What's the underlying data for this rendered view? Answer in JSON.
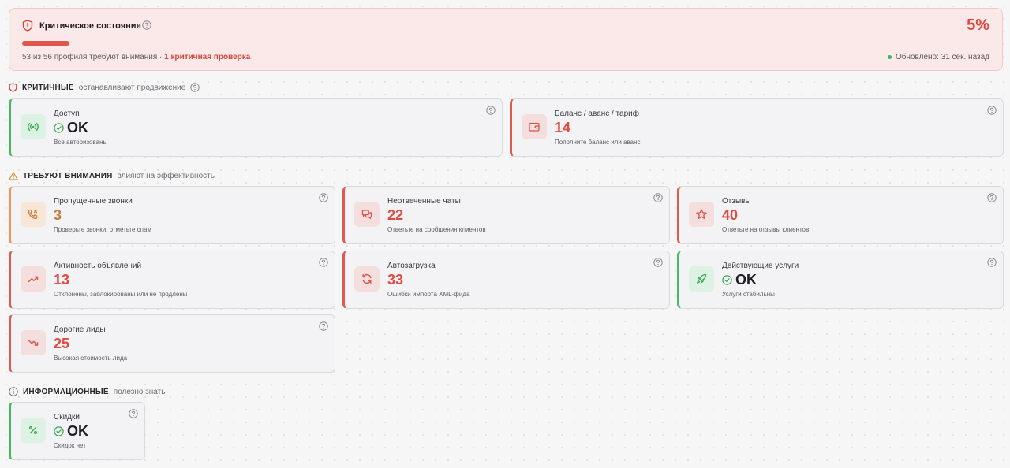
{
  "banner": {
    "title": "Критическое состояние",
    "percent": "5%",
    "progress_fraction": 0.05,
    "summary_main": "53 из 56 профиля требуют внимания · ",
    "summary_crit": "1 критичная проверка",
    "updated": "Обновлено: 31 сек. назад"
  },
  "sections": {
    "critical": {
      "title": "КРИТИЧНЫЕ",
      "subtitle": "останавливают продвижение"
    },
    "attention": {
      "title": "ТРЕБУЮТ ВНИМАНИЯ",
      "subtitle": "влияют на эффективность"
    },
    "info": {
      "title": "ИНФОРМАЦИОННЫЕ",
      "subtitle": "полезно знать"
    }
  },
  "cards": {
    "access": {
      "label": "Доступ",
      "value": "OK",
      "desc": "Все авторизованы",
      "icon": "signal-icon"
    },
    "balance": {
      "label": "Баланс / аванс / тариф",
      "value": "14",
      "desc": "Пополните баланс или аванс",
      "icon": "wallet-icon"
    },
    "missed_calls": {
      "label": "Пропущенные звонки",
      "value": "3",
      "desc": "Проверьте звонки, отметьте спам",
      "icon": "missed-call-icon"
    },
    "unanswered_chats": {
      "label": "Неотвеченные чаты",
      "value": "22",
      "desc": "Ответьте на сообщения клиентов",
      "icon": "chat-icon"
    },
    "reviews": {
      "label": "Отзывы",
      "value": "40",
      "desc": "Ответьте на отзывы клиентов",
      "icon": "star-icon"
    },
    "ads_activity": {
      "label": "Активность объявлений",
      "value": "13",
      "desc": "Отклонены, заблокированы или не продлены",
      "icon": "trending-up-icon"
    },
    "autoload": {
      "label": "Автозагрузка",
      "value": "33",
      "desc": "Ошибки импорта XML-фида",
      "icon": "refresh-icon"
    },
    "services": {
      "label": "Действующие услуги",
      "value": "OK",
      "desc": "Услуги стабильны",
      "icon": "rocket-icon"
    },
    "expensive_leads": {
      "label": "Дорогие лиды",
      "value": "25",
      "desc": "Высокая стоимость лида",
      "icon": "trending-down-icon"
    },
    "discounts": {
      "label": "Скидки",
      "value": "OK",
      "desc": "Скидок нет",
      "icon": "percent-icon"
    }
  },
  "colors": {
    "critical": "#e05a52",
    "ok": "#44bb65",
    "warning": "#e99a55",
    "banner_bg": "#fbe8e8"
  }
}
